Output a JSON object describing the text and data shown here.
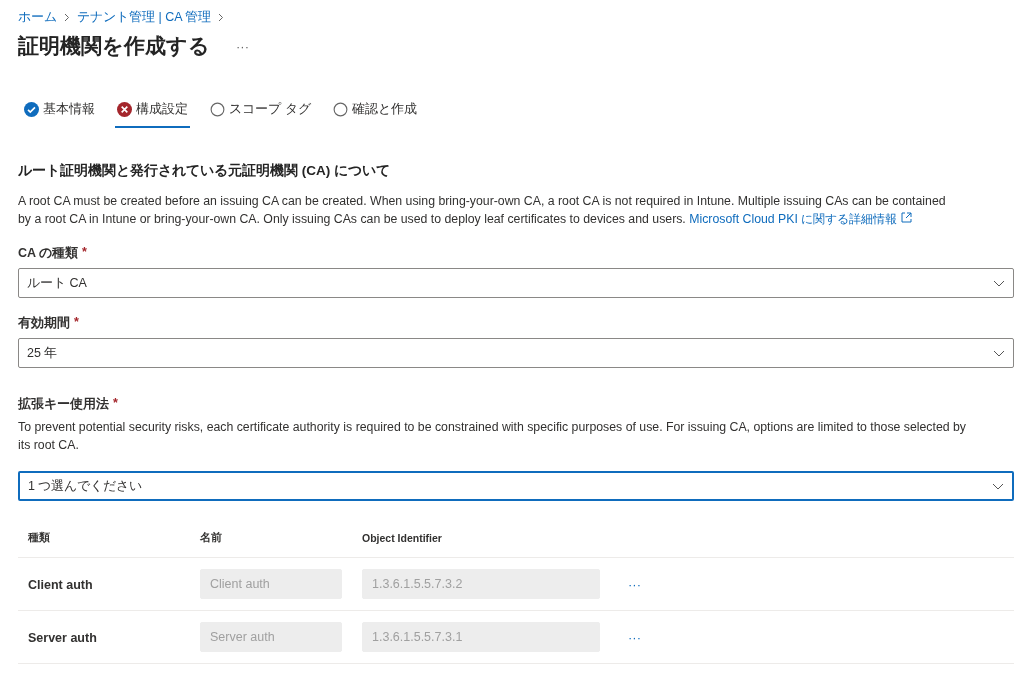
{
  "breadcrumb": [
    {
      "label": "ホーム"
    },
    {
      "label": "テナント管理 | CA 管理"
    }
  ],
  "title": "証明機関を作成する",
  "more": "···",
  "steps": [
    {
      "label": "基本情報",
      "kind": "done",
      "selected": false
    },
    {
      "label": "構成設定",
      "kind": "error",
      "selected": true
    },
    {
      "label": "スコープ タグ",
      "kind": "pending",
      "selected": false
    },
    {
      "label": "確認と作成",
      "kind": "pending",
      "selected": false
    }
  ],
  "section": {
    "heading": "ルート証明機関と発行されている元証明機関 (CA) について",
    "text": "A root CA must be created before an issuing CA can be created. When using bring-your-own CA, a root CA is not required in Intune. Multiple issuing CAs can be contained by a root CA in Intune or bring-your-own CA. Only issuing CAs can be used to deploy leaf certificates to devices and users.",
    "link": "Microsoft Cloud PKI に関する詳細情報"
  },
  "fields": [
    {
      "label": "CA の種類",
      "required": "*",
      "value": "ルート CA",
      "focused": false
    },
    {
      "label": "有効期間",
      "required": "*",
      "value": "25 年",
      "focused": false
    }
  ],
  "eku": {
    "label": "拡張キー使用法",
    "required": "*",
    "description": "To prevent potential security risks, each certificate authority is required to be constrained with specific purposes of use. For issuing CA, options are limited to those selected by its root CA.",
    "placeholder": "1 つ選んでください",
    "focused": true
  },
  "table": {
    "columns": [
      "種類",
      "名前",
      "Object Identifier"
    ],
    "rows": [
      {
        "type": "Client auth",
        "name": "Client auth",
        "oid": "1.3.6.1.5.5.7.3.2",
        "disabled": true,
        "more": "···"
      },
      {
        "type": "Server auth",
        "name": "Server auth",
        "oid": "1.3.6.1.5.5.7.3.1",
        "disabled": true,
        "more": "···"
      }
    ]
  }
}
